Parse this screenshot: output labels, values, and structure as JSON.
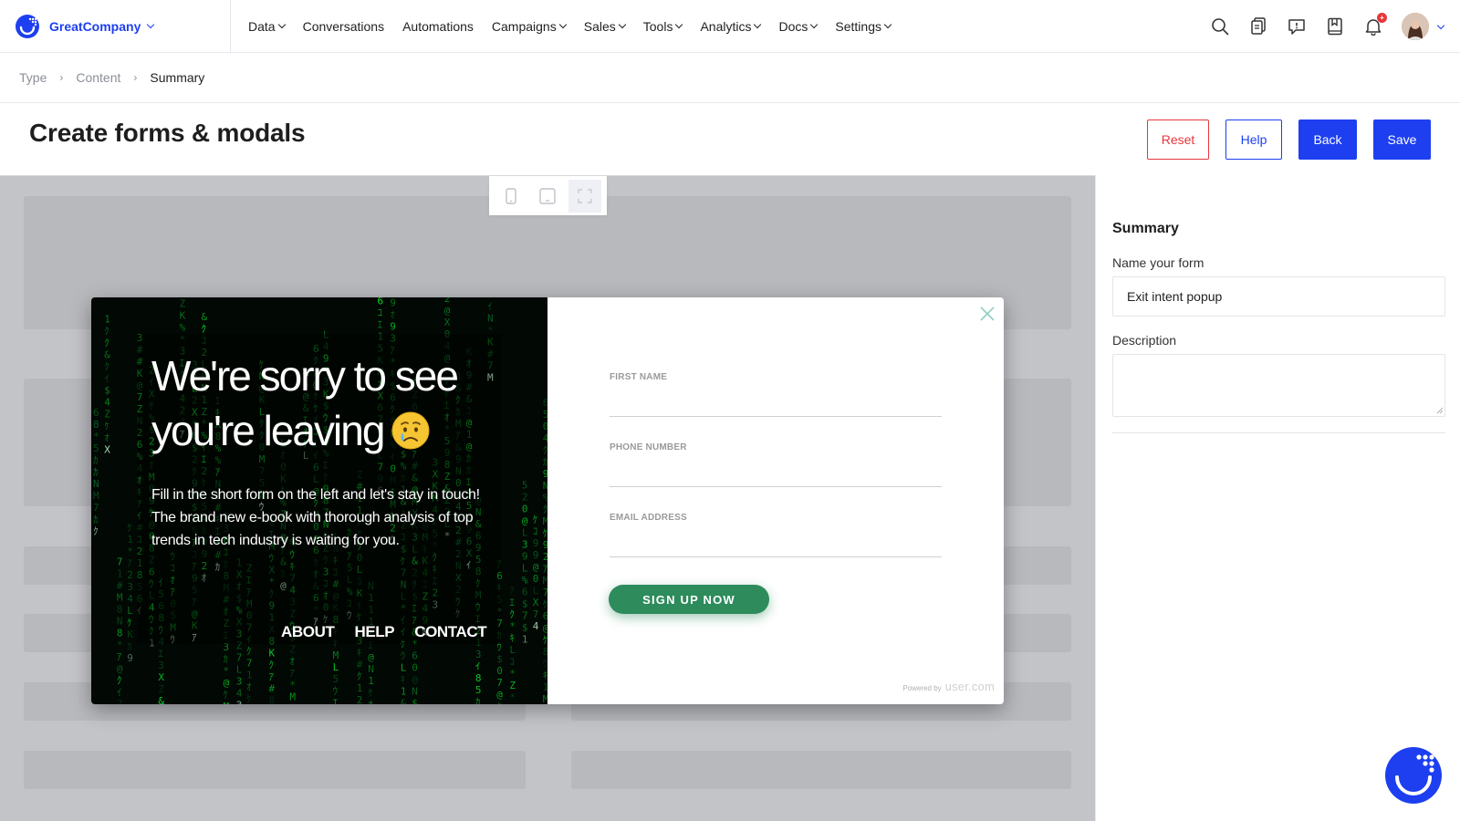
{
  "brand": {
    "name": "GreatCompany",
    "color": "#1d3ff0"
  },
  "nav": [
    {
      "label": "Data",
      "dropdown": true
    },
    {
      "label": "Conversations",
      "dropdown": false
    },
    {
      "label": "Automations",
      "dropdown": false
    },
    {
      "label": "Campaigns",
      "dropdown": true
    },
    {
      "label": "Sales",
      "dropdown": true
    },
    {
      "label": "Tools",
      "dropdown": true
    },
    {
      "label": "Analytics",
      "dropdown": true
    },
    {
      "label": "Docs",
      "dropdown": true
    },
    {
      "label": "Settings",
      "dropdown": true
    }
  ],
  "header_icons": [
    "search-icon",
    "documents-icon",
    "feedback-icon",
    "bookmark-icon",
    "bell-icon"
  ],
  "notifications_badge": "+",
  "breadcrumb": [
    "Type",
    "Content",
    "Summary"
  ],
  "breadcrumb_separator": "›",
  "page_title": "Create forms & modals",
  "actions": {
    "reset": "Reset",
    "help": "Help",
    "back": "Back",
    "save": "Save"
  },
  "device_toggle": [
    "mobile-icon",
    "tablet-icon",
    "fullscreen-icon"
  ],
  "modal": {
    "headline_line1": "We're sorry to see",
    "headline_line2": "you're leaving",
    "emoji": "crying-face-emoji",
    "body": "Fill in the short form on the left and let's stay in touch! The brand new e-book with thorough analysis of top trends in tech industry is waiting for you.",
    "links": [
      "ABOUT",
      "HELP",
      "CONTACT"
    ],
    "fields": [
      "FIRST NAME",
      "PHONE NUMBER",
      "EMAIL ADDRESS"
    ],
    "submit": "SIGN UP NOW",
    "submit_color": "#2e8b5c",
    "powered_by": "Powered by",
    "powered_brand": "user.com"
  },
  "summary": {
    "title": "Summary",
    "name_label": "Name your form",
    "name_value": "Exit intent popup",
    "description_label": "Description",
    "description_value": ""
  },
  "colors": {
    "danger": "#e8363c",
    "primary": "#1d3ff0",
    "preview_bg": "#c3c4c8"
  }
}
